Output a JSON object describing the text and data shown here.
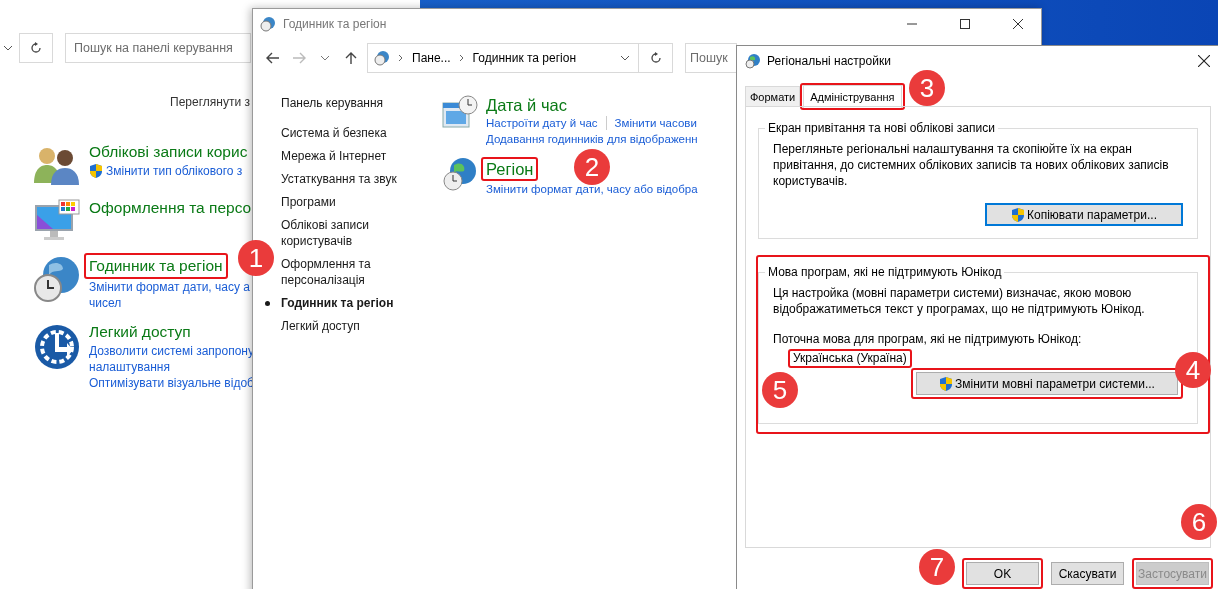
{
  "back_window": {
    "search": {
      "placeholder": "Пошук на панелі керування"
    },
    "view_by": "Переглянути з",
    "categories": [
      {
        "title": "Облікові записи корис",
        "highlighted": false,
        "links": [
          {
            "text": "Змінити тип облікового з",
            "shield": true
          }
        ]
      },
      {
        "title": "Оформлення та персо",
        "highlighted": false
      },
      {
        "title": "Годинник та регіон",
        "highlighted": true,
        "links": [
          {
            "text": "Змінити формат дати, часу а",
            "shield": false
          },
          {
            "text": "чисел",
            "shield": false
          }
        ]
      },
      {
        "title": "Легкий доступ",
        "highlighted": false,
        "links": [
          {
            "text": "Дозволити системі запропону",
            "shield": false
          },
          {
            "text": "налаштування",
            "shield": false
          },
          {
            "text": "Оптимізувати візуальне відоб",
            "shield": false
          }
        ]
      }
    ]
  },
  "main_window": {
    "title": "Годинник та регіон",
    "breadcrumb": [
      "Пане...",
      "Годинник та регіон"
    ],
    "search": {
      "placeholder": "Пошук"
    },
    "sidebar": {
      "home": "Панель керування",
      "items": [
        {
          "label": "Система й безпека",
          "selected": false
        },
        {
          "label": "Мережа й Інтернет",
          "selected": false
        },
        {
          "label": "Устаткування та звук",
          "selected": false
        },
        {
          "label": "Програми",
          "selected": false
        },
        {
          "label": "Облікові записи користувачів",
          "selected": false
        },
        {
          "label": "Оформлення та персоналізація",
          "selected": false
        },
        {
          "label": "Годинник та регіон",
          "selected": true
        },
        {
          "label": "Легкий доступ",
          "selected": false
        }
      ]
    },
    "sections": [
      {
        "title": "Дата й час",
        "highlighted": false,
        "link_rows": [
          [
            "Настроїти дату й час",
            "Змінити часови"
          ],
          [
            "Додавання годинників для відображенн"
          ]
        ]
      },
      {
        "title": "Регіон",
        "highlighted": true,
        "link_rows": [
          [
            "Змінити формат дати, часу або відобра"
          ]
        ]
      }
    ]
  },
  "dialog": {
    "title": "Регіональні настройки",
    "tabs": [
      {
        "label": "Формати",
        "selected": false,
        "highlighted": false
      },
      {
        "label": "Адміністрування",
        "selected": true,
        "highlighted": true
      }
    ],
    "groups": [
      {
        "title": "Екран привітання та нові облікові записи",
        "highlighted": false,
        "paragraphs": [
          "Перегляньте регіональні налаштування та скопіюйте їх на екран привітання, до системних облікових записів та нових облікових записів користувачів."
        ],
        "button": {
          "label": "Копіювати параметри...",
          "shield": true,
          "focused": true,
          "highlighted": false
        }
      },
      {
        "title": "Мова програм, які не підтримують Юнікод",
        "highlighted": true,
        "paragraphs": [
          "Ця настройка (мовні параметри системи) визначає, якою мовою відображатиметься текст у програмах, що не підтримують Юнікод.",
          "Поточна мова для програм, які не підтримують Юнікод:"
        ],
        "value": {
          "text": "Українська (Україна)",
          "highlighted": true
        },
        "button": {
          "label": "Змінити мовні параметри системи...",
          "shield": true,
          "focused": false,
          "highlighted": true
        }
      }
    ],
    "buttons": [
      {
        "label": "OK",
        "disabled": false,
        "highlighted": true
      },
      {
        "label": "Скасувати",
        "disabled": false,
        "highlighted": false
      },
      {
        "label": "Застосувати",
        "disabled": true,
        "highlighted": true
      }
    ]
  },
  "annotations": [
    {
      "number": "1"
    },
    {
      "number": "2"
    },
    {
      "number": "3"
    },
    {
      "number": "4"
    },
    {
      "number": "5"
    },
    {
      "number": "6"
    },
    {
      "number": "7"
    }
  ]
}
